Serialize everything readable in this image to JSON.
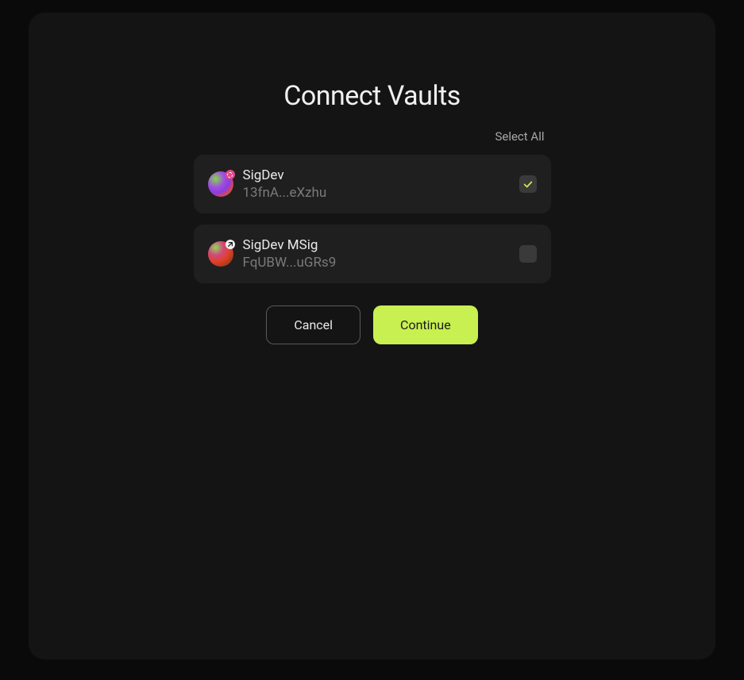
{
  "title": "Connect Vaults",
  "select_all_label": "Select All",
  "vaults": [
    {
      "name": "SigDev",
      "address": "13fnA...eXzhu",
      "checked": true,
      "badge": "pink"
    },
    {
      "name": "SigDev MSig",
      "address": "FqUBW...uGRs9",
      "checked": false,
      "badge": "white"
    }
  ],
  "buttons": {
    "cancel": "Cancel",
    "continue": "Continue"
  },
  "colors": {
    "accent": "#c8f050",
    "background": "#0a0a0a",
    "modal": "#141414",
    "item": "#1f1f1f"
  }
}
